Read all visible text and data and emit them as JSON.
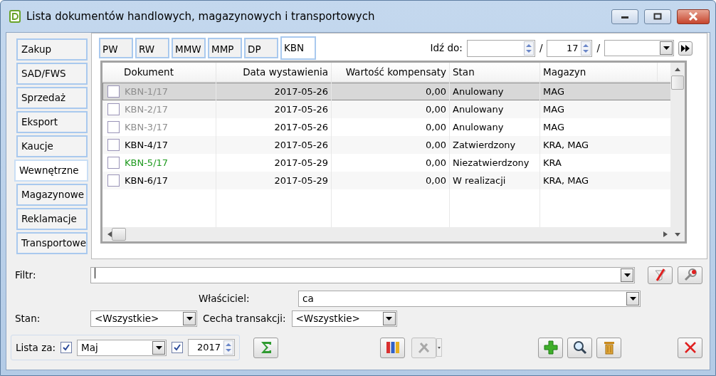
{
  "window": {
    "title": "Lista dokumentów handlowych, magazynowych i transportowych"
  },
  "side_tabs": [
    {
      "label": "Zakup",
      "selected": false
    },
    {
      "label": "SAD/FWS",
      "selected": false
    },
    {
      "label": "Sprzedaż",
      "selected": false
    },
    {
      "label": "Eksport",
      "selected": false
    },
    {
      "label": "Kaucje",
      "selected": false
    },
    {
      "label": "Wewnętrzne",
      "selected": true
    },
    {
      "label": "Magazynowe",
      "selected": false
    },
    {
      "label": "Reklamacje",
      "selected": false
    },
    {
      "label": "Transportowe",
      "selected": false
    }
  ],
  "doc_tabs": [
    {
      "label": "PW",
      "selected": false
    },
    {
      "label": "RW",
      "selected": false
    },
    {
      "label": "MMW",
      "selected": false
    },
    {
      "label": "MMP",
      "selected": false
    },
    {
      "label": "DP",
      "selected": false
    },
    {
      "label": "KBN",
      "selected": true
    }
  ],
  "goto": {
    "label": "Idź do:",
    "separator_1": "/",
    "number": "17",
    "separator_2": "/"
  },
  "table": {
    "columns": [
      "Dokument",
      "Data wystawienia",
      "Wartość kompensaty",
      "Stan",
      "Magazyn"
    ],
    "rows": [
      {
        "checked": false,
        "selected": true,
        "kind": "cancelled",
        "cells": [
          "KBN-1/17",
          "2017-05-26",
          "0,00",
          "Anulowany",
          "MAG"
        ]
      },
      {
        "checked": false,
        "selected": false,
        "kind": "cancelled",
        "cells": [
          "KBN-2/17",
          "2017-05-26",
          "0,00",
          "Anulowany",
          "MAG"
        ]
      },
      {
        "checked": false,
        "selected": false,
        "kind": "cancelled",
        "cells": [
          "KBN-3/17",
          "2017-05-26",
          "0,00",
          "Anulowany",
          "MAG"
        ]
      },
      {
        "checked": false,
        "selected": false,
        "kind": "confirmed",
        "cells": [
          "KBN-4/17",
          "2017-05-26",
          "0,00",
          "Zatwierdzony",
          "KRA, MAG"
        ]
      },
      {
        "checked": false,
        "selected": false,
        "kind": "unconfirmed",
        "cells": [
          "KBN-5/17",
          "2017-05-29",
          "0,00",
          "Niezatwierdzony",
          "KRA"
        ]
      },
      {
        "checked": false,
        "selected": false,
        "kind": "confirmed",
        "cells": [
          "KBN-6/17",
          "2017-05-29",
          "0,00",
          "W realizacji",
          "KRA, MAG"
        ]
      }
    ]
  },
  "filter": {
    "label": "Filtr:"
  },
  "owner": {
    "label": "Właściciel:",
    "value": "ca"
  },
  "state": {
    "label": "Stan:",
    "value": "<Wszystkie>"
  },
  "trait": {
    "label": "Cecha transakcji:",
    "value": "<Wszystkie>"
  },
  "period": {
    "label": "Lista za:",
    "month_checked": true,
    "month": "Maj",
    "year_checked": true,
    "year": "2017"
  },
  "tools_button": {
    "disabled": true
  }
}
